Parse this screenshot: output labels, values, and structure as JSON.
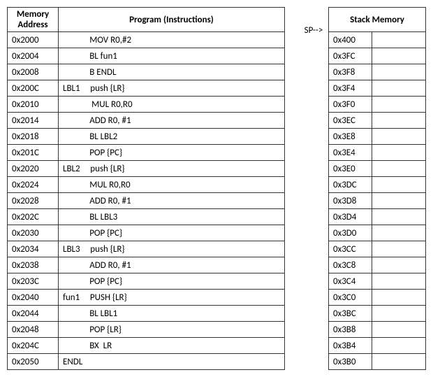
{
  "chart_data": {
    "type": "table",
    "tables": [
      {
        "name": "Program (Instructions)",
        "columns": [
          "Memory Address",
          "Program (Instructions)"
        ],
        "rows": [
          {
            "addr": "0x2000",
            "label": "",
            "instr": "MOV R0,#2"
          },
          {
            "addr": "0x2004",
            "label": "",
            "instr": "BL fun1"
          },
          {
            "addr": "0x2008",
            "label": "",
            "instr": "B ENDL"
          },
          {
            "addr": "0x200C",
            "label": "LBL1",
            "instr": "push {LR}"
          },
          {
            "addr": "0x2010",
            "label": "",
            "instr": "MUL R0,R0"
          },
          {
            "addr": "0x2014",
            "label": "",
            "instr": "ADD R0, #1"
          },
          {
            "addr": "0x2018",
            "label": "",
            "instr": "BL LBL2"
          },
          {
            "addr": "0x201C",
            "label": "",
            "instr": "POP {PC}"
          },
          {
            "addr": "0x2020",
            "label": "LBL2",
            "instr": "push {LR}"
          },
          {
            "addr": "0x2024",
            "label": "",
            "instr": "MUL R0,R0"
          },
          {
            "addr": "0x2028",
            "label": "",
            "instr": "ADD R0, #1"
          },
          {
            "addr": "0x202C",
            "label": "",
            "instr": "BL LBL3"
          },
          {
            "addr": "0x2030",
            "label": "",
            "instr": "POP {PC}"
          },
          {
            "addr": "0x2034",
            "label": "LBL3",
            "instr": "push {LR}"
          },
          {
            "addr": "0x2038",
            "label": "",
            "instr": "ADD R0, #1"
          },
          {
            "addr": "0x203C",
            "label": "",
            "instr": "POP {PC}"
          },
          {
            "addr": "0x2040",
            "label": "fun1",
            "instr": "PUSH {LR}"
          },
          {
            "addr": "0x2044",
            "label": "",
            "instr": "BL LBL1"
          },
          {
            "addr": "0x2048",
            "label": "",
            "instr": "POP {LR}"
          },
          {
            "addr": "0x204C",
            "label": "",
            "instr": "BX  LR"
          },
          {
            "addr": "0x2050",
            "label": "ENDL",
            "instr": ""
          }
        ]
      },
      {
        "name": "Stack Memory",
        "columns": [
          "Stack Memory"
        ],
        "sp_label": "SP-->",
        "rows": [
          {
            "addr": "0x400",
            "val": ""
          },
          {
            "addr": "0x3FC",
            "val": ""
          },
          {
            "addr": "0x3F8",
            "val": ""
          },
          {
            "addr": "0x3F4",
            "val": ""
          },
          {
            "addr": "0x3F0",
            "val": ""
          },
          {
            "addr": "0x3EC",
            "val": ""
          },
          {
            "addr": "0x3E8",
            "val": ""
          },
          {
            "addr": "0x3E4",
            "val": ""
          },
          {
            "addr": "0x3E0",
            "val": ""
          },
          {
            "addr": "0x3DC",
            "val": ""
          },
          {
            "addr": "0x3D8",
            "val": ""
          },
          {
            "addr": "0x3D4",
            "val": ""
          },
          {
            "addr": "0x3D0",
            "val": ""
          },
          {
            "addr": "0x3CC",
            "val": ""
          },
          {
            "addr": "0x3C8",
            "val": ""
          },
          {
            "addr": "0x3C4",
            "val": ""
          },
          {
            "addr": "0x3C0",
            "val": ""
          },
          {
            "addr": "0x3BC",
            "val": ""
          },
          {
            "addr": "0x3B8",
            "val": ""
          },
          {
            "addr": "0x3B4",
            "val": ""
          },
          {
            "addr": "0x3B0",
            "val": ""
          }
        ]
      }
    ]
  },
  "program": {
    "header_addr": "Memory\nAddress",
    "header_instr": "Program (Instructions)",
    "rows": [
      {
        "addr": "0x2000",
        "cell": "             MOV R0,#2"
      },
      {
        "addr": "0x2004",
        "cell": "             BL fun1"
      },
      {
        "addr": "0x2008",
        "cell": "             B ENDL"
      },
      {
        "addr": "0x200C",
        "cell": "LBL1     push {LR}"
      },
      {
        "addr": "0x2010",
        "cell": "              MUL R0,R0"
      },
      {
        "addr": "0x2014",
        "cell": "             ADD R0, #1"
      },
      {
        "addr": "0x2018",
        "cell": "             BL LBL2"
      },
      {
        "addr": "0x201C",
        "cell": "             POP {PC}"
      },
      {
        "addr": "0x2020",
        "cell": "LBL2     push {LR}"
      },
      {
        "addr": "0x2024",
        "cell": "             MUL R0,R0"
      },
      {
        "addr": "0x2028",
        "cell": "             ADD R0, #1"
      },
      {
        "addr": "0x202C",
        "cell": "             BL LBL3"
      },
      {
        "addr": "0x2030",
        "cell": "             POP {PC}"
      },
      {
        "addr": "0x2034",
        "cell": "LBL3     push {LR}"
      },
      {
        "addr": "0x2038",
        "cell": "             ADD R0, #1"
      },
      {
        "addr": "0x203C",
        "cell": "             POP {PC}"
      },
      {
        "addr": "0x2040",
        "cell": "fun1     PUSH {LR}"
      },
      {
        "addr": "0x2044",
        "cell": "             BL LBL1"
      },
      {
        "addr": "0x2048",
        "cell": "             POP {LR}"
      },
      {
        "addr": "0x204C",
        "cell": "             BX  LR"
      },
      {
        "addr": "0x2050",
        "cell": "ENDL"
      }
    ]
  },
  "stack": {
    "header": "Stack Memory",
    "sp_label": "SP-->",
    "rows": [
      {
        "addr": "0x400",
        "val": ""
      },
      {
        "addr": "0x3FC",
        "val": ""
      },
      {
        "addr": "0x3F8",
        "val": ""
      },
      {
        "addr": "0x3F4",
        "val": ""
      },
      {
        "addr": "0x3F0",
        "val": ""
      },
      {
        "addr": "0x3EC",
        "val": ""
      },
      {
        "addr": "0x3E8",
        "val": ""
      },
      {
        "addr": "0x3E4",
        "val": ""
      },
      {
        "addr": "0x3E0",
        "val": ""
      },
      {
        "addr": "0x3DC",
        "val": ""
      },
      {
        "addr": "0x3D8",
        "val": ""
      },
      {
        "addr": "0x3D4",
        "val": ""
      },
      {
        "addr": "0x3D0",
        "val": ""
      },
      {
        "addr": "0x3CC",
        "val": ""
      },
      {
        "addr": "0x3C8",
        "val": ""
      },
      {
        "addr": "0x3C4",
        "val": ""
      },
      {
        "addr": "0x3C0",
        "val": ""
      },
      {
        "addr": "0x3BC",
        "val": ""
      },
      {
        "addr": "0x3B8",
        "val": ""
      },
      {
        "addr": "0x3B4",
        "val": ""
      },
      {
        "addr": "0x3B0",
        "val": ""
      }
    ]
  }
}
